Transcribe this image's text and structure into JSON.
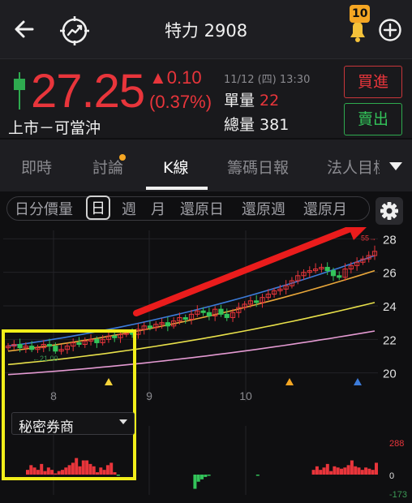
{
  "header": {
    "title": "特力 2908",
    "notification_count": "10",
    "icons": [
      "back-arrow-icon",
      "trend-chart-icon",
      "bell-icon",
      "add-circle-icon"
    ]
  },
  "quote": {
    "price": "27.25",
    "change": "▲0.10",
    "change_pct": "(0.37%)",
    "market_label": "上市－可當沖",
    "timestamp": "11/12 (四) 13:30",
    "unit_volume_label": "單量",
    "unit_volume": "22",
    "total_volume_label": "總量",
    "total_volume": "381",
    "buy_label": "買進",
    "sell_label": "賣出",
    "colors": {
      "up": "#e8353b",
      "down": "#33c45a"
    }
  },
  "tabs": [
    {
      "label": "即時",
      "active": false
    },
    {
      "label": "討論",
      "active": false,
      "has_dot": true
    },
    {
      "label": "K線",
      "active": true
    },
    {
      "label": "籌碼日報",
      "active": false
    },
    {
      "label": "法人目標",
      "active": false
    }
  ],
  "periods": [
    {
      "label": "日分價量",
      "active": false
    },
    {
      "label": "日",
      "active": true
    },
    {
      "label": "週",
      "active": false
    },
    {
      "label": "月",
      "active": false
    },
    {
      "label": "還原日",
      "active": false
    },
    {
      "label": "還原週",
      "active": false
    },
    {
      "label": "還原月",
      "active": false
    }
  ],
  "chart_data": {
    "type": "candlestick",
    "x_ticks": [
      "8",
      "9",
      "10"
    ],
    "y_ticks": [
      "28",
      "26",
      "24",
      "22",
      "20"
    ],
    "y_range": [
      19.5,
      28.5
    ],
    "price_annotations": {
      "low": "←21.00",
      "high": "55→"
    },
    "closes": [
      21.6,
      21.7,
      21.5,
      21.6,
      21.4,
      21.5,
      21.7,
      21.6,
      21.3,
      21.4,
      21.6,
      21.8,
      21.7,
      21.9,
      22.0,
      21.8,
      22.0,
      22.2,
      22.1,
      22.3,
      22.4,
      22.3,
      22.6,
      22.8,
      22.7,
      22.9,
      23.0,
      22.8,
      23.1,
      23.3,
      23.2,
      23.5,
      23.7,
      23.6,
      23.4,
      23.8,
      23.5,
      23.3,
      23.6,
      23.9,
      24.1,
      24.3,
      24.2,
      24.5,
      24.7,
      24.9,
      25.0,
      25.2,
      25.5,
      25.8,
      26.0,
      26.1,
      26.2,
      26.3,
      26.1,
      25.8,
      25.7,
      26.2,
      26.4,
      26.6,
      26.8,
      27.0,
      27.25
    ],
    "ma_series": [
      {
        "color": "#3c7bd9",
        "start": 21.6,
        "end": 27.0
      },
      {
        "color": "#e8a63a",
        "start": 21.3,
        "end": 26.1
      },
      {
        "color": "#e8e04a",
        "start": 20.5,
        "end": 24.2
      },
      {
        "color": "#e49ad2",
        "start": 19.9,
        "end": 22.5
      }
    ],
    "volume_axis": [
      "288",
      "0",
      "-173"
    ],
    "volume": [
      40,
      80,
      60,
      40,
      90,
      30,
      60,
      40,
      10,
      30,
      40,
      60,
      80,
      100,
      140,
      70,
      120,
      120,
      90,
      70,
      20,
      60,
      40,
      80,
      100,
      20,
      -10,
      0,
      0,
      0,
      0,
      0,
      0,
      0,
      0,
      0,
      0,
      0,
      0,
      0,
      0,
      0,
      0,
      0,
      0,
      0,
      0,
      0,
      -120,
      -60,
      -40,
      -20,
      -10,
      0,
      0,
      0,
      0,
      0,
      0,
      0,
      0,
      0,
      0,
      0,
      0,
      0,
      -10,
      0,
      0,
      0,
      0,
      0,
      0,
      0,
      0,
      0,
      0,
      0,
      0,
      0,
      0,
      0,
      40,
      70,
      40,
      60,
      90,
      30,
      70,
      60,
      50,
      60,
      80,
      120,
      70,
      60,
      40,
      60,
      50,
      40,
      100
    ],
    "markers": [
      {
        "color": "#f5d33a"
      },
      {
        "color": "#f5a623"
      },
      {
        "color": "#3c7bd9"
      }
    ]
  },
  "indicator_select": {
    "label": "秘密券商"
  }
}
